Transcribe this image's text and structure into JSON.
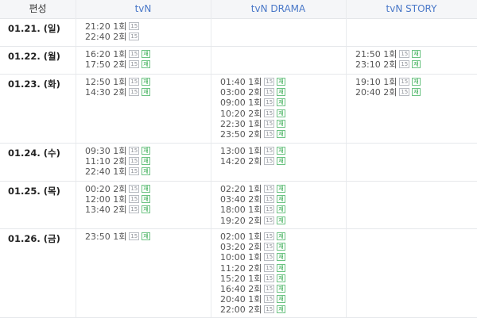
{
  "headers": {
    "first": "편성",
    "tvn": "tvN",
    "tvn_drama": "tvN DRAMA",
    "tvn_story": "tvN STORY"
  },
  "badges": {
    "age": "15",
    "rerun": "재"
  },
  "rows": [
    {
      "date": "01.21. (일)",
      "tvn": [
        {
          "time": "21:20 1회",
          "rerun": false
        },
        {
          "time": "22:40 2회",
          "rerun": false
        }
      ],
      "drama": [],
      "story": []
    },
    {
      "date": "01.22. (월)",
      "tvn": [
        {
          "time": "16:20 1회",
          "rerun": true
        },
        {
          "time": "17:50 2회",
          "rerun": true
        }
      ],
      "drama": [],
      "story": [
        {
          "time": "21:50 1회",
          "rerun": true
        },
        {
          "time": "23:10 2회",
          "rerun": true
        }
      ]
    },
    {
      "date": "01.23. (화)",
      "tvn": [
        {
          "time": "12:50 1회",
          "rerun": true
        },
        {
          "time": "14:30 2회",
          "rerun": true
        }
      ],
      "drama": [
        {
          "time": "01:40 1회",
          "rerun": true
        },
        {
          "time": "03:00 2회",
          "rerun": true
        },
        {
          "time": "09:00 1회",
          "rerun": true
        },
        {
          "time": "10:20 2회",
          "rerun": true
        },
        {
          "time": "22:30 1회",
          "rerun": true
        },
        {
          "time": "23:50 2회",
          "rerun": true
        }
      ],
      "story": [
        {
          "time": "19:10 1회",
          "rerun": true
        },
        {
          "time": "20:40 2회",
          "rerun": true
        }
      ]
    },
    {
      "date": "01.24. (수)",
      "tvn": [
        {
          "time": "09:30 1회",
          "rerun": true
        },
        {
          "time": "11:10 2회",
          "rerun": true
        },
        {
          "time": "22:40 1회",
          "rerun": true
        }
      ],
      "drama": [
        {
          "time": "13:00 1회",
          "rerun": true
        },
        {
          "time": "14:20 2회",
          "rerun": true
        }
      ],
      "story": []
    },
    {
      "date": "01.25. (목)",
      "tvn": [
        {
          "time": "00:20 2회",
          "rerun": true
        },
        {
          "time": "12:00 1회",
          "rerun": true
        },
        {
          "time": "13:40 2회",
          "rerun": true
        }
      ],
      "drama": [
        {
          "time": "02:20 1회",
          "rerun": true
        },
        {
          "time": "03:40 2회",
          "rerun": true
        },
        {
          "time": "18:00 1회",
          "rerun": true
        },
        {
          "time": "19:20 2회",
          "rerun": true
        }
      ],
      "story": []
    },
    {
      "date": "01.26. (금)",
      "tvn": [
        {
          "time": "23:50 1회",
          "rerun": true
        }
      ],
      "drama": [
        {
          "time": "02:00 1회",
          "rerun": true
        },
        {
          "time": "03:20 2회",
          "rerun": true
        },
        {
          "time": "10:00 1회",
          "rerun": true
        },
        {
          "time": "11:20 2회",
          "rerun": true
        },
        {
          "time": "15:20 1회",
          "rerun": true
        },
        {
          "time": "16:40 2회",
          "rerun": true
        },
        {
          "time": "20:40 1회",
          "rerun": true
        },
        {
          "time": "22:00 2회",
          "rerun": true
        }
      ],
      "story": []
    }
  ]
}
